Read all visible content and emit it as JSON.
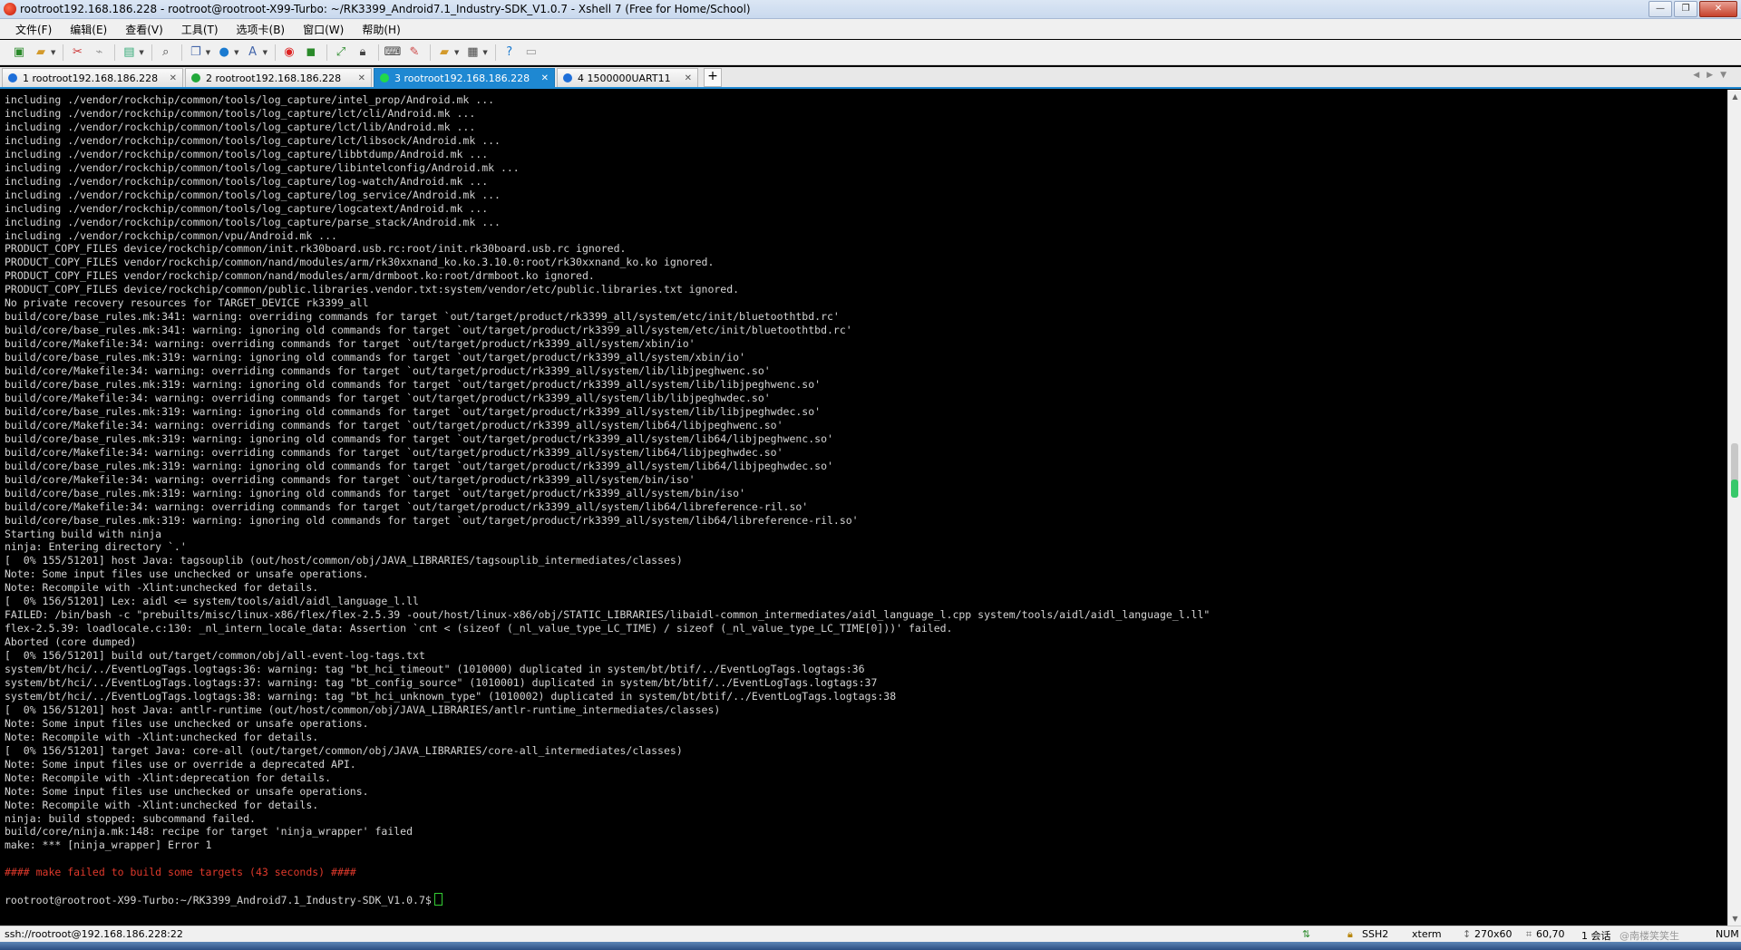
{
  "window": {
    "title": "rootroot192.168.186.228 - rootroot@rootroot-X99-Turbo: ~/RK3399_Android7.1_Industry-SDK_V1.0.7 - Xshell 7 (Free for Home/School)",
    "controls": [
      "—",
      "❐",
      "✕"
    ]
  },
  "menu": [
    "文件(F)",
    "编辑(E)",
    "查看(V)",
    "工具(T)",
    "选项卡(B)",
    "窗口(W)",
    "帮助(H)"
  ],
  "tabs": [
    {
      "label": "1 rootroot192.168.186.228",
      "status_color": "#1e6fd9",
      "active": false
    },
    {
      "label": "2 rootroot192.168.186.228",
      "status_color": "#22a83a",
      "active": false
    },
    {
      "label": "3 rootroot192.168.186.228",
      "status_color": "#22a83a",
      "active": true
    },
    {
      "label": "4 1500000UART11",
      "status_color": "#1e6fd9",
      "active": false
    }
  ],
  "tab_add": "+",
  "terminal": {
    "lines": [
      "including ./vendor/rockchip/common/tools/log_capture/intel_prop/Android.mk ...",
      "including ./vendor/rockchip/common/tools/log_capture/lct/cli/Android.mk ...",
      "including ./vendor/rockchip/common/tools/log_capture/lct/lib/Android.mk ...",
      "including ./vendor/rockchip/common/tools/log_capture/lct/libsock/Android.mk ...",
      "including ./vendor/rockchip/common/tools/log_capture/libbtdump/Android.mk ...",
      "including ./vendor/rockchip/common/tools/log_capture/libintelconfig/Android.mk ...",
      "including ./vendor/rockchip/common/tools/log_capture/log-watch/Android.mk ...",
      "including ./vendor/rockchip/common/tools/log_capture/log_service/Android.mk ...",
      "including ./vendor/rockchip/common/tools/log_capture/logcatext/Android.mk ...",
      "including ./vendor/rockchip/common/tools/log_capture/parse_stack/Android.mk ...",
      "including ./vendor/rockchip/common/vpu/Android.mk ...",
      "PRODUCT_COPY_FILES device/rockchip/common/init.rk30board.usb.rc:root/init.rk30board.usb.rc ignored.",
      "PRODUCT_COPY_FILES vendor/rockchip/common/nand/modules/arm/rk30xxnand_ko.ko.3.10.0:root/rk30xxnand_ko.ko ignored.",
      "PRODUCT_COPY_FILES vendor/rockchip/common/nand/modules/arm/drmboot.ko:root/drmboot.ko ignored.",
      "PRODUCT_COPY_FILES device/rockchip/common/public.libraries.vendor.txt:system/vendor/etc/public.libraries.txt ignored.",
      "No private recovery resources for TARGET_DEVICE rk3399_all",
      "build/core/base_rules.mk:341: warning: overriding commands for target `out/target/product/rk3399_all/system/etc/init/bluetoothtbd.rc'",
      "build/core/base_rules.mk:341: warning: ignoring old commands for target `out/target/product/rk3399_all/system/etc/init/bluetoothtbd.rc'",
      "build/core/Makefile:34: warning: overriding commands for target `out/target/product/rk3399_all/system/xbin/io'",
      "build/core/base_rules.mk:319: warning: ignoring old commands for target `out/target/product/rk3399_all/system/xbin/io'",
      "build/core/Makefile:34: warning: overriding commands for target `out/target/product/rk3399_all/system/lib/libjpeghwenc.so'",
      "build/core/base_rules.mk:319: warning: ignoring old commands for target `out/target/product/rk3399_all/system/lib/libjpeghwenc.so'",
      "build/core/Makefile:34: warning: overriding commands for target `out/target/product/rk3399_all/system/lib/libjpeghwdec.so'",
      "build/core/base_rules.mk:319: warning: ignoring old commands for target `out/target/product/rk3399_all/system/lib/libjpeghwdec.so'",
      "build/core/Makefile:34: warning: overriding commands for target `out/target/product/rk3399_all/system/lib64/libjpeghwenc.so'",
      "build/core/base_rules.mk:319: warning: ignoring old commands for target `out/target/product/rk3399_all/system/lib64/libjpeghwenc.so'",
      "build/core/Makefile:34: warning: overriding commands for target `out/target/product/rk3399_all/system/lib64/libjpeghwdec.so'",
      "build/core/base_rules.mk:319: warning: ignoring old commands for target `out/target/product/rk3399_all/system/lib64/libjpeghwdec.so'",
      "build/core/Makefile:34: warning: overriding commands for target `out/target/product/rk3399_all/system/bin/iso'",
      "build/core/base_rules.mk:319: warning: ignoring old commands for target `out/target/product/rk3399_all/system/bin/iso'",
      "build/core/Makefile:34: warning: overriding commands for target `out/target/product/rk3399_all/system/lib64/libreference-ril.so'",
      "build/core/base_rules.mk:319: warning: ignoring old commands for target `out/target/product/rk3399_all/system/lib64/libreference-ril.so'",
      "Starting build with ninja",
      "ninja: Entering directory `.'",
      "[  0% 155/51201] host Java: tagsouplib (out/host/common/obj/JAVA_LIBRARIES/tagsouplib_intermediates/classes)",
      "Note: Some input files use unchecked or unsafe operations.",
      "Note: Recompile with -Xlint:unchecked for details.",
      "[  0% 156/51201] Lex: aidl <= system/tools/aidl/aidl_language_l.ll",
      "FAILED: /bin/bash -c \"prebuilts/misc/linux-x86/flex/flex-2.5.39 -oout/host/linux-x86/obj/STATIC_LIBRARIES/libaidl-common_intermediates/aidl_language_l.cpp system/tools/aidl/aidl_language_l.ll\"",
      "flex-2.5.39: loadlocale.c:130: _nl_intern_locale_data: Assertion `cnt < (sizeof (_nl_value_type_LC_TIME) / sizeof (_nl_value_type_LC_TIME[0]))' failed.",
      "Aborted (core dumped)",
      "[  0% 156/51201] build out/target/common/obj/all-event-log-tags.txt",
      "system/bt/hci/../EventLogTags.logtags:36: warning: tag \"bt_hci_timeout\" (1010000) duplicated in system/bt/btif/../EventLogTags.logtags:36",
      "system/bt/hci/../EventLogTags.logtags:37: warning: tag \"bt_config_source\" (1010001) duplicated in system/bt/btif/../EventLogTags.logtags:37",
      "system/bt/hci/../EventLogTags.logtags:38: warning: tag \"bt_hci_unknown_type\" (1010002) duplicated in system/bt/btif/../EventLogTags.logtags:38",
      "[  0% 156/51201] host Java: antlr-runtime (out/host/common/obj/JAVA_LIBRARIES/antlr-runtime_intermediates/classes)",
      "Note: Some input files use unchecked or unsafe operations.",
      "Note: Recompile with -Xlint:unchecked for details.",
      "[  0% 156/51201] target Java: core-all (out/target/common/obj/JAVA_LIBRARIES/core-all_intermediates/classes)",
      "Note: Some input files use or override a deprecated API.",
      "Note: Recompile with -Xlint:deprecation for details.",
      "Note: Some input files use unchecked or unsafe operations.",
      "Note: Recompile with -Xlint:unchecked for details.",
      "ninja: build stopped: subcommand failed.",
      "build/core/ninja.mk:148: recipe for target 'ninja_wrapper' failed",
      "make: *** [ninja_wrapper] Error 1",
      "",
      "#### make failed to build some targets (43 seconds) ####",
      ""
    ],
    "error_line": "#### make failed to build some targets (43 seconds) ####",
    "error_color": "#e0392b",
    "prompt": "rootroot@rootroot-X99-Turbo:~/RK3399_Android7.1_Industry-SDK_V1.0.7$"
  },
  "statusbar": {
    "connection": "ssh://rootroot@192.168.186.228:22",
    "protocol": "SSH2",
    "terminal_type": "xterm",
    "size": "270x60",
    "cursor_pos": "60,70",
    "sessions": "1 会话",
    "watermark": "@南楼笑笑生",
    "num": "NUM"
  }
}
